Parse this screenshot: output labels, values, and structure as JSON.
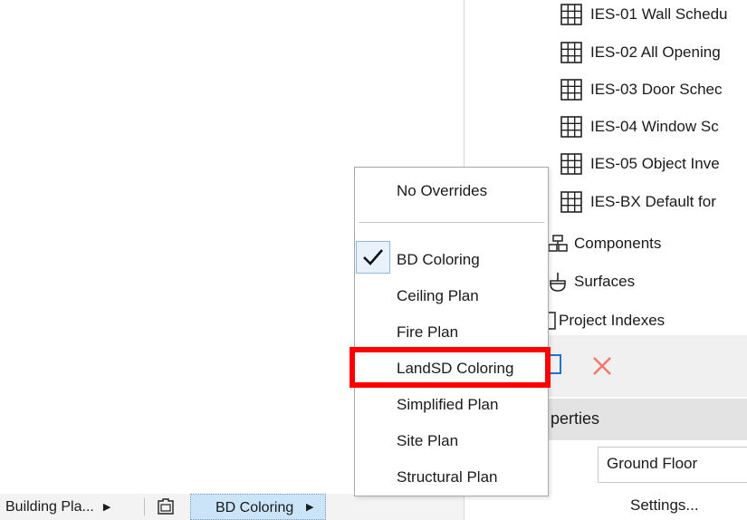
{
  "navigator": {
    "schedules": [
      "IES-01 Wall Schedu",
      "IES-02 All Opening",
      "IES-03 Door Schec",
      "IES-04 Window Sc",
      "IES-05 Object Inve",
      "IES-BX Default for"
    ],
    "components_label": "Components",
    "surfaces_label": "Surfaces",
    "project_indexes_label": "Project Indexes"
  },
  "properties": {
    "header": "perties",
    "story_value": "Ground Floor",
    "settings_label": "Settings..."
  },
  "status_bar": {
    "view_label": "Building Pla...",
    "override_label": "BD Coloring"
  },
  "override_menu": {
    "no_overrides": "No Overrides",
    "items": [
      {
        "label": "BD Coloring",
        "checked": true
      },
      {
        "label": "Ceiling Plan",
        "checked": false
      },
      {
        "label": "Fire Plan",
        "checked": false
      },
      {
        "label": "LandSD Coloring",
        "checked": false,
        "highlighted": true
      },
      {
        "label": "Simplified Plan",
        "checked": false
      },
      {
        "label": "Site Plan",
        "checked": false
      },
      {
        "label": "Structural Plan",
        "checked": false
      }
    ]
  },
  "colors": {
    "highlight": "#ff0000",
    "delete_icon": "#f4776f",
    "accent_blue": "#1e73d8",
    "selection_bg": "#cce4f7"
  }
}
